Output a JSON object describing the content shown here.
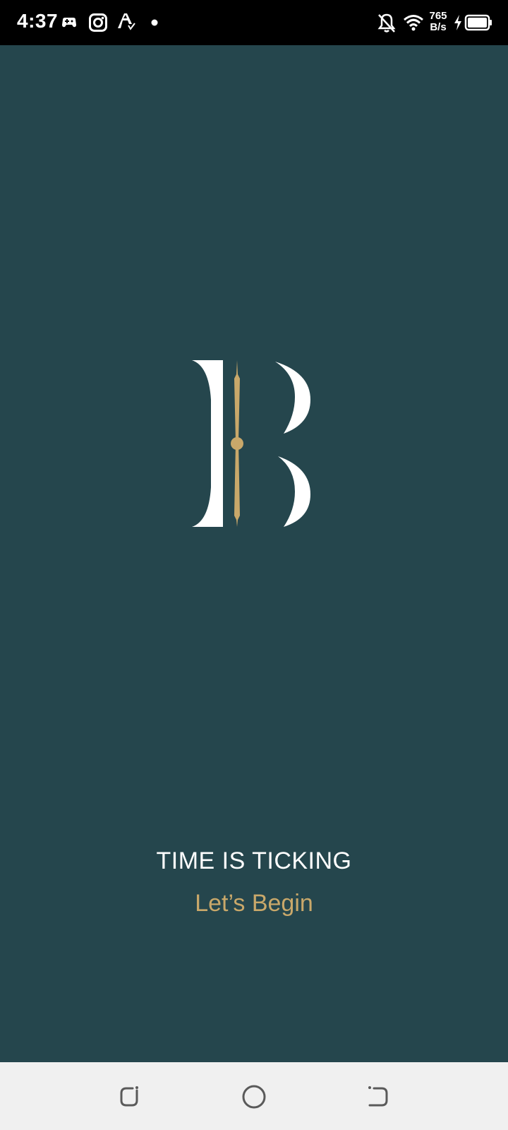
{
  "status_bar": {
    "time": "4:37",
    "net_speed_value": "765",
    "net_speed_unit": "B/s",
    "icons": [
      "gamepad-icon",
      "instagram-icon",
      "font-icon",
      "dot-icon",
      "bell-off-icon",
      "wifi-icon",
      "charging-icon",
      "battery-icon"
    ]
  },
  "splash": {
    "logo_icon": "clock-b-logo",
    "tagline": "TIME IS TICKING",
    "cta_label": "Let’s Begin"
  },
  "nav_bar": {
    "icons": [
      "recents-icon",
      "home-icon",
      "back-icon"
    ]
  },
  "colors": {
    "background": "#25464d",
    "accent": "#c9a86a",
    "status_bar": "#000000",
    "nav_bar": "#f0f0f0"
  }
}
